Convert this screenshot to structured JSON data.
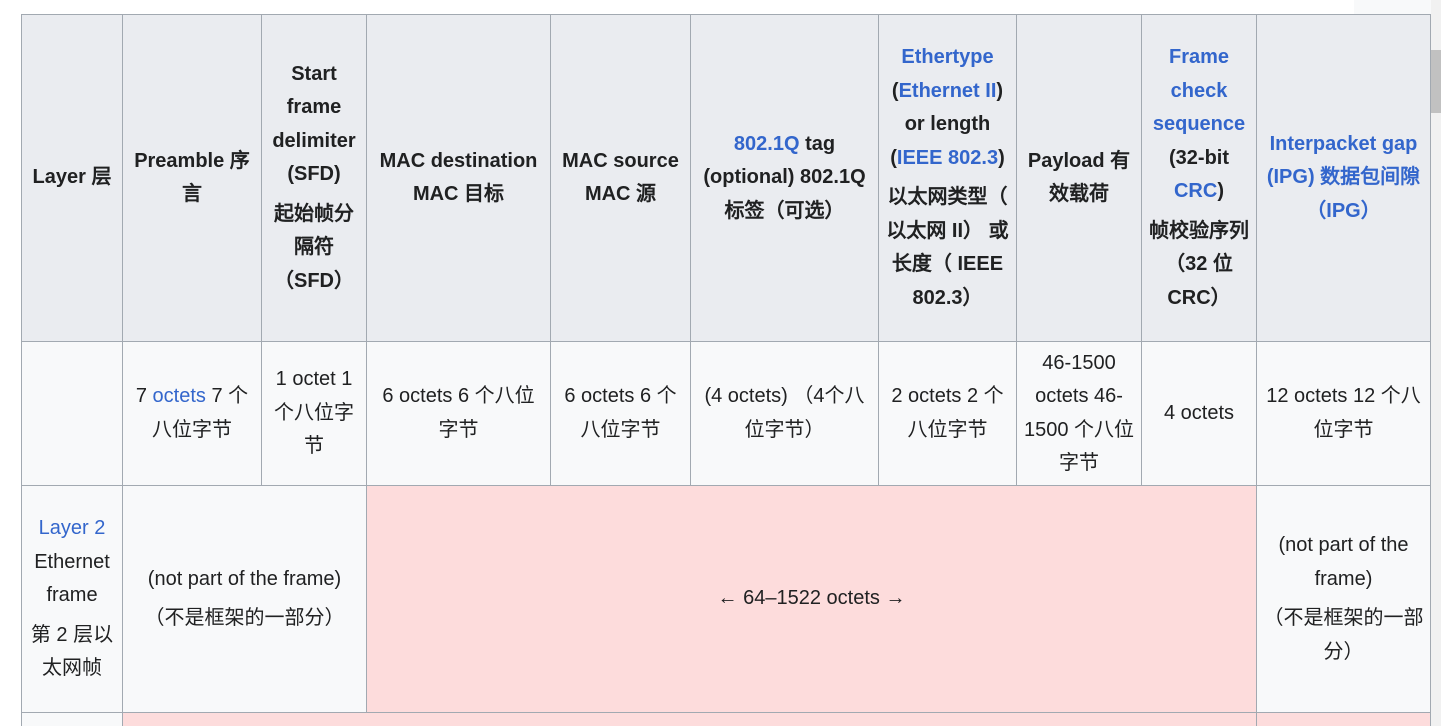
{
  "header": {
    "layer": "Layer 层",
    "preamble": "Preamble 序言",
    "sfd_en": "Start frame delimiter (SFD)",
    "sfd_zh": "起始帧分隔符（SFD）",
    "mac_dst": "MAC destination MAC 目标",
    "mac_src": "MAC source MAC 源",
    "tag_link": "802.1Q",
    "tag_rest": " tag (optional) 802.1Q 标签（可选）",
    "ethertype_link": "Ethertype",
    "ethertype_open": " (",
    "ethernet2_link": "Ethernet II",
    "ethertype_mid": ") or length (",
    "ieee_link": "IEEE 802.3",
    "ethertype_close": ")",
    "ethertype_zh": "以太网类型（ 以太网 II） 或长度（ IEEE 802.3）",
    "payload": "Payload 有效载荷",
    "fcs_link": "Frame check sequence",
    "fcs_rest": " (32-bit ",
    "crc_link": "CRC",
    "fcs_close": ")",
    "fcs_zh": "帧校验序列（32 位 CRC）",
    "ipg": "Interpacket gap (IPG) 数据包间隙 （IPG）"
  },
  "sizes": {
    "layer": "",
    "preamble_num": "7 ",
    "preamble_link": "octets",
    "preamble_rest": " 7 个八位字节",
    "sfd": "1 octet 1 个八位字节",
    "mac_dst": "6 octets 6 个八位字节",
    "mac_src": "6 octets 6 个八位字节",
    "tag": "(4 octets) （4个八位字节）",
    "ethertype": "2 octets 2 个八位字节",
    "payload": "46-1500 octets 46-1500 个八位字节",
    "fcs": "4 octets",
    "ipg": "12 octets  12 个八位字节"
  },
  "layer2": {
    "link": "Layer 2",
    "label_en": "Ethernet frame",
    "label_zh": "第 2 层以太网帧",
    "not_part_en": "(not part of the frame)",
    "not_part_zh": "（不是框架的一部分）",
    "frame_size": "← 64–1522 octets →",
    "ipg_en": "(not part of the frame)",
    "ipg_zh": "（不是框架的一部分）"
  },
  "colors": {
    "link": "#3366cc",
    "frame": "#fddcdc",
    "header_bg": "#eaecf0"
  }
}
